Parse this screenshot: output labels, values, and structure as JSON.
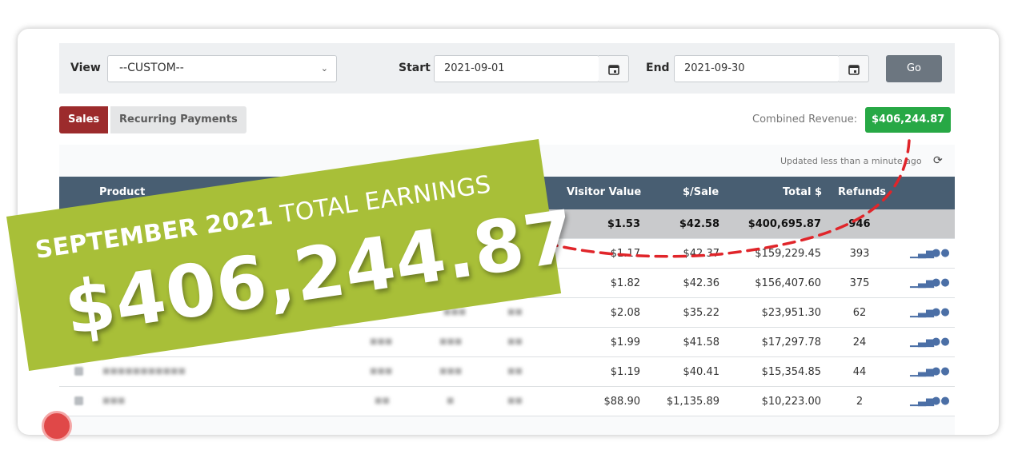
{
  "filter": {
    "view_label": "View",
    "view_value": "--CUSTOM--",
    "start_label": "Start",
    "start_value": "2021-09-01",
    "end_label": "End",
    "end_value": "2021-09-30",
    "go_label": "Go"
  },
  "tabs": [
    {
      "label": "Sales",
      "active": true
    },
    {
      "label": "Recurring Payments",
      "active": false
    }
  ],
  "revenue": {
    "label": "Combined Revenue:",
    "value": "$406,244.87",
    "color": "#27a845"
  },
  "updated_text": "Updated less than a minute ago",
  "table": {
    "headers": {
      "product": "Product",
      "visitor_value": "Visitor Value",
      "per_sale": "$/Sale",
      "total": "Total $",
      "refunds": "Refunds"
    },
    "total_row": {
      "visitor_value": "$1.53",
      "per_sale": "$42.58",
      "total": "$400,695.87",
      "refunds": "946"
    },
    "rows": [
      {
        "visitor_value": "$1.17",
        "per_sale": "$42.37",
        "total": "$159,229.45",
        "refunds": "393"
      },
      {
        "visitor_value": "$1.82",
        "per_sale": "$42.36",
        "total": "$156,407.60",
        "refunds": "375"
      },
      {
        "visitor_value": "$2.08",
        "per_sale": "$35.22",
        "total": "$23,951.30",
        "refunds": "62"
      },
      {
        "visitor_value": "$1.99",
        "per_sale": "$41.58",
        "total": "$17,297.78",
        "refunds": "24"
      },
      {
        "visitor_value": "$1.19",
        "per_sale": "$40.41",
        "total": "$15,354.85",
        "refunds": "44"
      },
      {
        "visitor_value": "$88.90",
        "per_sale": "$1,135.89",
        "total": "$10,223.00",
        "refunds": "2"
      }
    ]
  },
  "banner": {
    "line1_bold": "SEPTEMBER 2021",
    "line1_rest": "TOTAL EARNINGS",
    "amount": "$406,244.87",
    "color": "#a8bf38"
  },
  "accent_red": "#9c2b2c",
  "header_bg": "#485e72"
}
